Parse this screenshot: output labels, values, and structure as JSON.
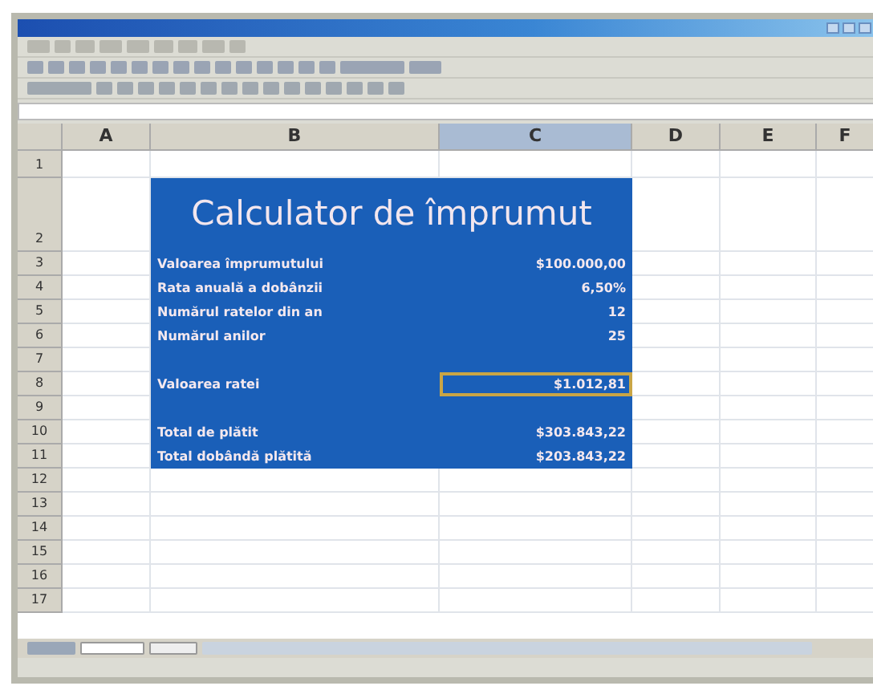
{
  "columns": [
    {
      "label": "A",
      "selected": false
    },
    {
      "label": "B",
      "selected": false
    },
    {
      "label": "C",
      "selected": true
    },
    {
      "label": "D",
      "selected": false
    },
    {
      "label": "E",
      "selected": false
    },
    {
      "label": "F",
      "selected": false
    }
  ],
  "rows": [
    "1",
    "2",
    "3",
    "4",
    "5",
    "6",
    "7",
    "8",
    "9",
    "10",
    "11",
    "12",
    "13",
    "14",
    "15",
    "16",
    "17"
  ],
  "calculator": {
    "title": "Calculator de împrumut",
    "entries": [
      {
        "kind": "field",
        "label": "Valoarea împrumutului",
        "value": "$100.000,00",
        "selected": false
      },
      {
        "kind": "field",
        "label": "Rata anuală a dobânzii",
        "value": "6,50%",
        "selected": false
      },
      {
        "kind": "field",
        "label": "Numărul ratelor din an",
        "value": "12",
        "selected": false
      },
      {
        "kind": "field",
        "label": "Numărul anilor",
        "value": "25",
        "selected": false
      },
      {
        "kind": "blank"
      },
      {
        "kind": "field",
        "label": "Valoarea ratei",
        "value": "$1.012,81",
        "selected": true
      },
      {
        "kind": "blank"
      },
      {
        "kind": "field",
        "label": "Total de plătit",
        "value": "$303.843,22",
        "selected": false
      },
      {
        "kind": "field",
        "label": "Total dobândă plătită",
        "value": "$203.843,22",
        "selected": false
      }
    ]
  }
}
